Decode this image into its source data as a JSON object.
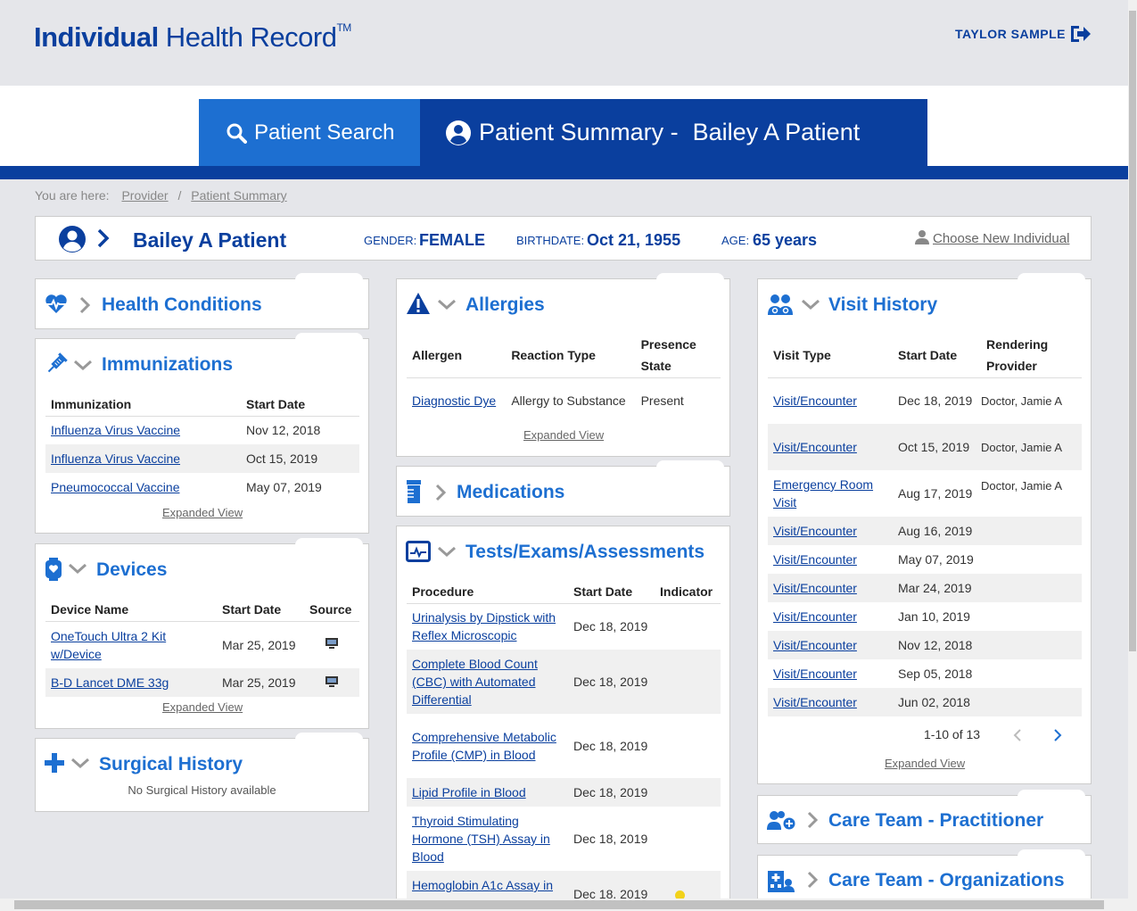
{
  "header": {
    "logo_bold": "Individual",
    "logo_rest": " Health Record",
    "logo_tm": "TM",
    "user": "TAYLOR SAMPLE",
    "logout_icon": "sign-out-icon"
  },
  "tabs": {
    "search": "Patient Search",
    "summary_prefix": "Patient Summary -",
    "summary_name": "Bailey A Patient"
  },
  "breadcrumb": {
    "prefix": "You are here:",
    "items": [
      "Provider",
      "Patient Summary"
    ],
    "sep": "/"
  },
  "patient": {
    "name": "Bailey A Patient",
    "gender_label": "GENDER:",
    "gender": "FEMALE",
    "birth_label": "BIRTHDATE:",
    "birthdate": "Oct 21, 1955",
    "age_label": "AGE:",
    "age": "65 years",
    "choose": "Choose New Individual"
  },
  "health_conditions": {
    "title": "Health Conditions"
  },
  "immunizations": {
    "title": "Immunizations",
    "headers": [
      "Immunization",
      "Start Date"
    ],
    "rows": [
      [
        "Influenza Virus Vaccine",
        "Nov 12, 2018"
      ],
      [
        "Influenza Virus Vaccine",
        "Oct 15, 2019"
      ],
      [
        "Pneumococcal Vaccine",
        "May 07, 2019"
      ]
    ],
    "expanded": "Expanded View"
  },
  "devices": {
    "title": "Devices",
    "headers": [
      "Device Name",
      "Start Date",
      "Source"
    ],
    "rows": [
      [
        "OneTouch Ultra 2 Kit w/Device",
        "Mar 25, 2019"
      ],
      [
        "B-D Lancet DME 33g",
        "Mar 25, 2019"
      ]
    ],
    "expanded": "Expanded View"
  },
  "surgical": {
    "title": "Surgical History",
    "empty": "No Surgical History available"
  },
  "allergies": {
    "title": "Allergies",
    "headers": [
      "Allergen",
      "Reaction Type",
      "Presence State"
    ],
    "rows": [
      [
        "Diagnostic Dye",
        "Allergy to Substance",
        "Present"
      ]
    ],
    "expanded": "Expanded View"
  },
  "medications": {
    "title": "Medications"
  },
  "tests": {
    "title": "Tests/Exams/Assessments",
    "headers": [
      "Procedure",
      "Start Date",
      "Indicator"
    ],
    "rows": [
      [
        "Urinalysis by Dipstick with Reflex Microscopic",
        "Dec 18, 2019"
      ],
      [
        "Complete Blood Count (CBC) with Automated Differential",
        "Dec 18, 2019"
      ],
      [
        "Comprehensive Metabolic Profile (CMP) in Blood",
        "Dec 18, 2019"
      ],
      [
        "Lipid Profile in Blood",
        "Dec 18, 2019"
      ],
      [
        "Thyroid Stimulating Hormone (TSH) Assay in Blood",
        "Dec 18, 2019"
      ],
      [
        "Hemoglobin A1c Assay in",
        "Dec 18, 2019"
      ]
    ],
    "indicator_color": "#f2d21a"
  },
  "visits": {
    "title": "Visit History",
    "headers": [
      "Visit Type",
      "Start Date",
      "Rendering Provider"
    ],
    "rows": [
      [
        "Visit/Encounter",
        "Dec 18, 2019",
        "Doctor, Jamie A"
      ],
      [
        "Visit/Encounter",
        "Oct 15, 2019",
        "Doctor, Jamie A"
      ],
      [
        "Emergency Room Visit",
        "Aug 17, 2019",
        "Doctor, Jamie A"
      ],
      [
        "Visit/Encounter",
        "Aug 16, 2019",
        ""
      ],
      [
        "Visit/Encounter",
        "May 07, 2019",
        ""
      ],
      [
        "Visit/Encounter",
        "Mar 24, 2019",
        ""
      ],
      [
        "Visit/Encounter",
        "Jan 10, 2019",
        ""
      ],
      [
        "Visit/Encounter",
        "Nov 12, 2018",
        ""
      ],
      [
        "Visit/Encounter",
        "Sep 05, 2018",
        ""
      ],
      [
        "Visit/Encounter",
        "Jun 02, 2018",
        ""
      ]
    ],
    "pager": "1-10 of 13",
    "expanded": "Expanded View"
  },
  "care_team_practitioner": {
    "title": "Care Team - Practitioner"
  },
  "care_team_orgs": {
    "title": "Care Team - Organizations"
  },
  "colors": {
    "brand_dark": "#0a3f9e",
    "brand_light": "#1d6fd1"
  }
}
